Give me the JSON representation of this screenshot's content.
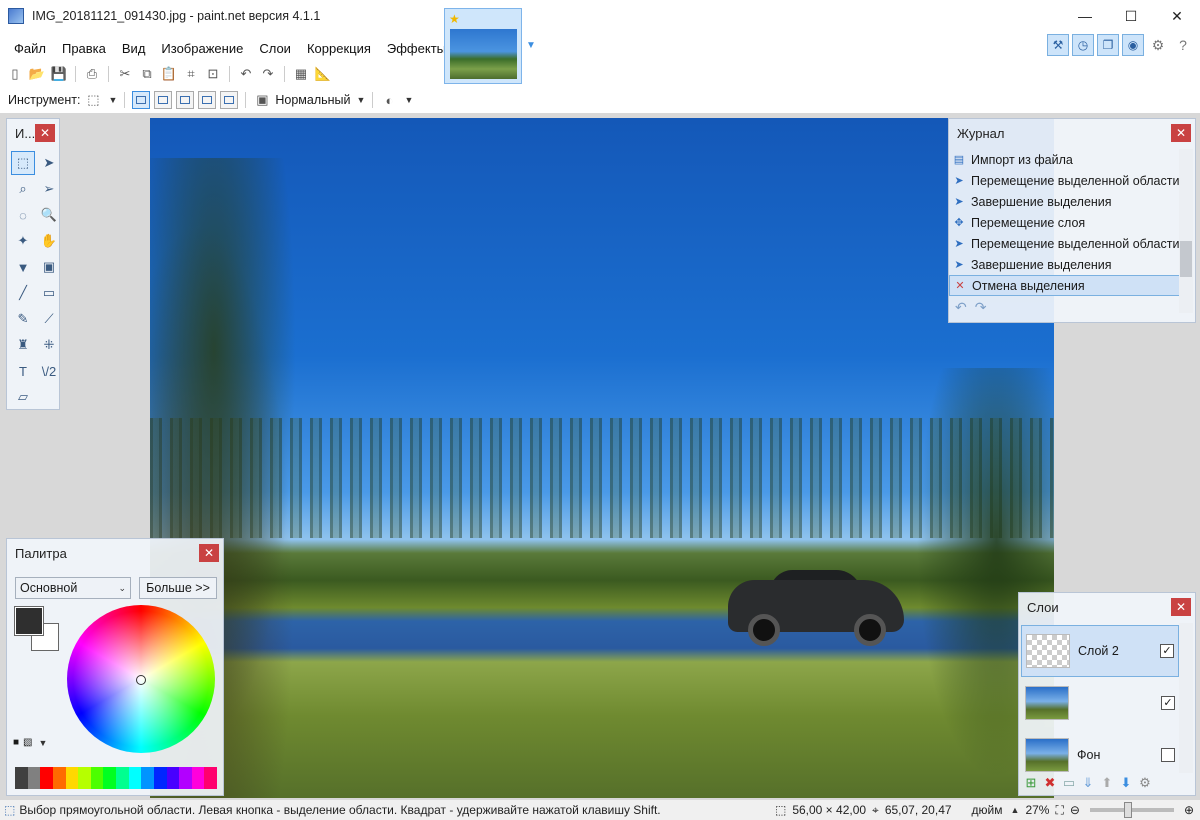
{
  "window": {
    "title": "IMG_20181121_091430.jpg - paint.net версия 4.1.1",
    "controls": {
      "minimize": "—",
      "maximize": "☐",
      "close": "✕"
    }
  },
  "menu": [
    "Файл",
    "Правка",
    "Вид",
    "Изображение",
    "Слои",
    "Коррекция",
    "Эффекты"
  ],
  "toolbar": {
    "tool_label": "Инструмент:",
    "blend_mode": "Нормальный"
  },
  "tools_panel": {
    "title": "И...",
    "tools": [
      {
        "name": "rectangle-select-icon",
        "glyph": "⬚",
        "active": true
      },
      {
        "name": "move-selected-pixels-icon",
        "glyph": "➤",
        "active": false
      },
      {
        "name": "lasso-select-icon",
        "glyph": "⌕",
        "active": false
      },
      {
        "name": "move-selection-icon",
        "glyph": "➢",
        "active": false
      },
      {
        "name": "ellipse-select-icon",
        "glyph": "◌",
        "active": false
      },
      {
        "name": "zoom-icon",
        "glyph": "🔍",
        "active": false
      },
      {
        "name": "magic-wand-icon",
        "glyph": "✦",
        "active": false
      },
      {
        "name": "pan-icon",
        "glyph": "✋",
        "active": false
      },
      {
        "name": "paint-bucket-icon",
        "glyph": "▼",
        "active": false
      },
      {
        "name": "gradient-icon",
        "glyph": "▣",
        "active": false
      },
      {
        "name": "paintbrush-icon",
        "glyph": "╱",
        "active": false
      },
      {
        "name": "eraser-icon",
        "glyph": "▭",
        "active": false
      },
      {
        "name": "pencil-icon",
        "glyph": "✎",
        "active": false
      },
      {
        "name": "color-picker-icon",
        "glyph": "⟋",
        "active": false
      },
      {
        "name": "clone-stamp-icon",
        "glyph": "♜",
        "active": false
      },
      {
        "name": "recolor-icon",
        "glyph": "⁜",
        "active": false
      },
      {
        "name": "text-icon",
        "glyph": "T",
        "active": false
      },
      {
        "name": "line-curve-icon",
        "glyph": "\\/2",
        "active": false
      },
      {
        "name": "shapes-icon",
        "glyph": "▱",
        "active": false
      }
    ]
  },
  "history": {
    "title": "Журнал",
    "items": [
      {
        "label": "Импорт из файла",
        "icon": "import-icon",
        "selected": false
      },
      {
        "label": "Перемещение выделенной области",
        "icon": "move-selection-icon",
        "selected": false
      },
      {
        "label": "Завершение выделения",
        "icon": "finish-selection-icon",
        "selected": false
      },
      {
        "label": "Перемещение слоя",
        "icon": "move-layer-icon",
        "selected": false
      },
      {
        "label": "Перемещение выделенной области",
        "icon": "move-selection-icon",
        "selected": false
      },
      {
        "label": "Завершение выделения",
        "icon": "finish-selection-icon",
        "selected": false
      },
      {
        "label": "Отмена выделения",
        "icon": "deselect-icon",
        "selected": true
      }
    ]
  },
  "palette": {
    "title": "Палитра",
    "mode": "Основной",
    "more_button": "Больше >>",
    "primary_color": "#2f2f2f",
    "secondary_color": "#ffffff",
    "swatches": [
      "#404040",
      "#808080",
      "#ff0000",
      "#ff6a00",
      "#ffd800",
      "#b6ff00",
      "#4cff00",
      "#00ff21",
      "#00ff90",
      "#00ffff",
      "#0094ff",
      "#0026ff",
      "#4800ff",
      "#b200ff",
      "#ff00dc",
      "#ff006e"
    ]
  },
  "layers": {
    "title": "Слои",
    "items": [
      {
        "name": "Слой 2",
        "visible": true,
        "selected": true,
        "thumb": "transparent"
      },
      {
        "name": "",
        "visible": true,
        "selected": false,
        "thumb": "photo"
      },
      {
        "name": "Фон",
        "visible": false,
        "selected": false,
        "thumb": "photo"
      }
    ]
  },
  "status": {
    "hint": "Выбор прямоугольной области. Левая кнопка - выделение области. Квадрат - удерживайте нажатой клавишу Shift.",
    "selection_size": "56,00 × 42,00",
    "cursor_pos": "65,07, 20,47",
    "units": "дюйм",
    "zoom": "27%"
  }
}
